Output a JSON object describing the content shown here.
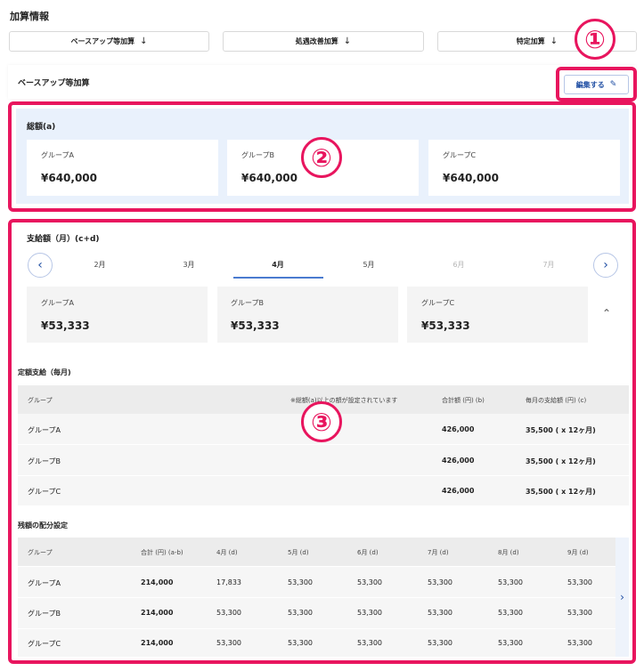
{
  "page": {
    "title": "加算情報"
  },
  "tabs": [
    {
      "label": "ベースアップ等加算",
      "arrow": "↓"
    },
    {
      "label": "処遇改善加算",
      "arrow": "↓"
    },
    {
      "label": "特定加算",
      "arrow": "↓"
    }
  ],
  "section": {
    "title": "ベースアップ等加算",
    "edit_label": "編集する",
    "edit_icon": "pencil-icon"
  },
  "total": {
    "title": "総額(a)",
    "cards": [
      {
        "label": "グループA",
        "value": "¥640,000"
      },
      {
        "label": "グループB",
        "value": "¥640,000"
      },
      {
        "label": "グループC",
        "value": "¥640,000"
      }
    ]
  },
  "monthly": {
    "title": "支給額（月）(c+d)",
    "months": [
      "2月",
      "3月",
      "4月",
      "5月",
      "6月",
      "7月"
    ],
    "selected_month": "4月",
    "prev": "‹",
    "next": "›",
    "cards": [
      {
        "label": "グループA",
        "value": "¥53,333"
      },
      {
        "label": "グループB",
        "value": "¥53,333"
      },
      {
        "label": "グループC",
        "value": "¥53,333"
      }
    ],
    "collapse": "⌃"
  },
  "fixed": {
    "title": "定額支給（毎月)",
    "headers": [
      "グループ",
      "※総額(a)以上の額が設定されています",
      "合計額 (円) (b)",
      "毎月の支給額 (円) (c)"
    ],
    "rows": [
      {
        "group": "グループA",
        "total": "426,000",
        "monthly": "35,500 ( x 12ヶ月)"
      },
      {
        "group": "グループB",
        "total": "426,000",
        "monthly": "35,500 ( x 12ヶ月)"
      },
      {
        "group": "グループC",
        "total": "426,000",
        "monthly": "35,500 ( x 12ヶ月)"
      }
    ]
  },
  "remainder": {
    "title": "残額の配分設定",
    "headers": [
      "グループ",
      "合計 (円) (a-b)",
      "4月 (d)",
      "5月 (d)",
      "6月 (d)",
      "7月 (d)",
      "8月 (d)",
      "9月 (d)"
    ],
    "rows": [
      {
        "group": "グループA",
        "sum": "214,000",
        "m": [
          "17,833",
          "53,300",
          "53,300",
          "53,300",
          "53,300",
          "53,300"
        ]
      },
      {
        "group": "グループB",
        "sum": "214,000",
        "m": [
          "53,300",
          "53,300",
          "53,300",
          "53,300",
          "53,300",
          "53,300"
        ]
      },
      {
        "group": "グループC",
        "sum": "214,000",
        "m": [
          "53,300",
          "53,300",
          "53,300",
          "53,300",
          "53,300",
          "53,300"
        ]
      }
    ],
    "scroll": "›"
  },
  "callouts": [
    "①",
    "②",
    "③"
  ],
  "colors": {
    "highlight": "#e8155e",
    "accent": "#1f4ea3",
    "panel": "#e9f1fc"
  }
}
